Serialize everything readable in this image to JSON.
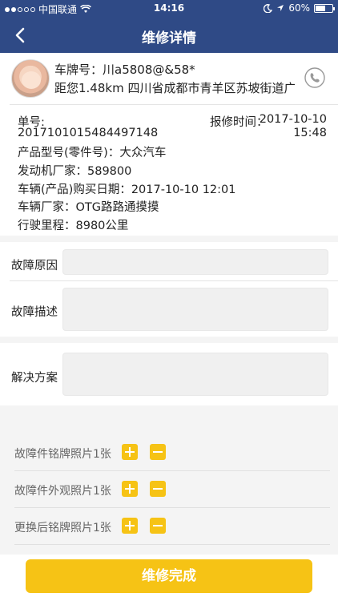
{
  "status": {
    "carrier": "中国联通",
    "network": "wifi",
    "time": "14:16",
    "battery": "60%",
    "battery_fraction": 0.6
  },
  "nav": {
    "title": "维修详情"
  },
  "customer": {
    "plate": "车牌号：川a5808@&58*",
    "address": "距您1.48km 四川省成都市青羊区苏坡街道广…"
  },
  "order": {
    "order_no_label": "单号:",
    "order_no": "2017101015484497148",
    "repair_time_label": "报修时间：",
    "repair_time_date": "2017-10-10",
    "repair_time_clock": "15:48",
    "product_model": "产品型号(零件号)：大众汽车",
    "engine_maker": "发动机厂家：589800",
    "purchase_date": "车辆(产品)购买日期：2017-10-10 12:01",
    "vehicle_maker": "车辆厂家：OTG路路通摸摸",
    "mileage": "行驶里程：8980公里"
  },
  "fault": {
    "cause_label": "故障原因",
    "desc_label": "故障描述"
  },
  "solution": {
    "label": "解决方案"
  },
  "photos": [
    {
      "label": "故障件铭牌照片1张"
    },
    {
      "label": "故障件外观照片1张"
    },
    {
      "label": "更换后铭牌照片1张"
    }
  ],
  "action": {
    "complete_label": "维修完成"
  },
  "colors": {
    "nav": "#2f4a86",
    "accent": "#f6c315"
  },
  "icons": [
    "back-chevron-icon",
    "phone-icon",
    "plus-icon",
    "minus-icon",
    "wifi-icon",
    "location-icon",
    "moon-icon",
    "battery-icon"
  ]
}
